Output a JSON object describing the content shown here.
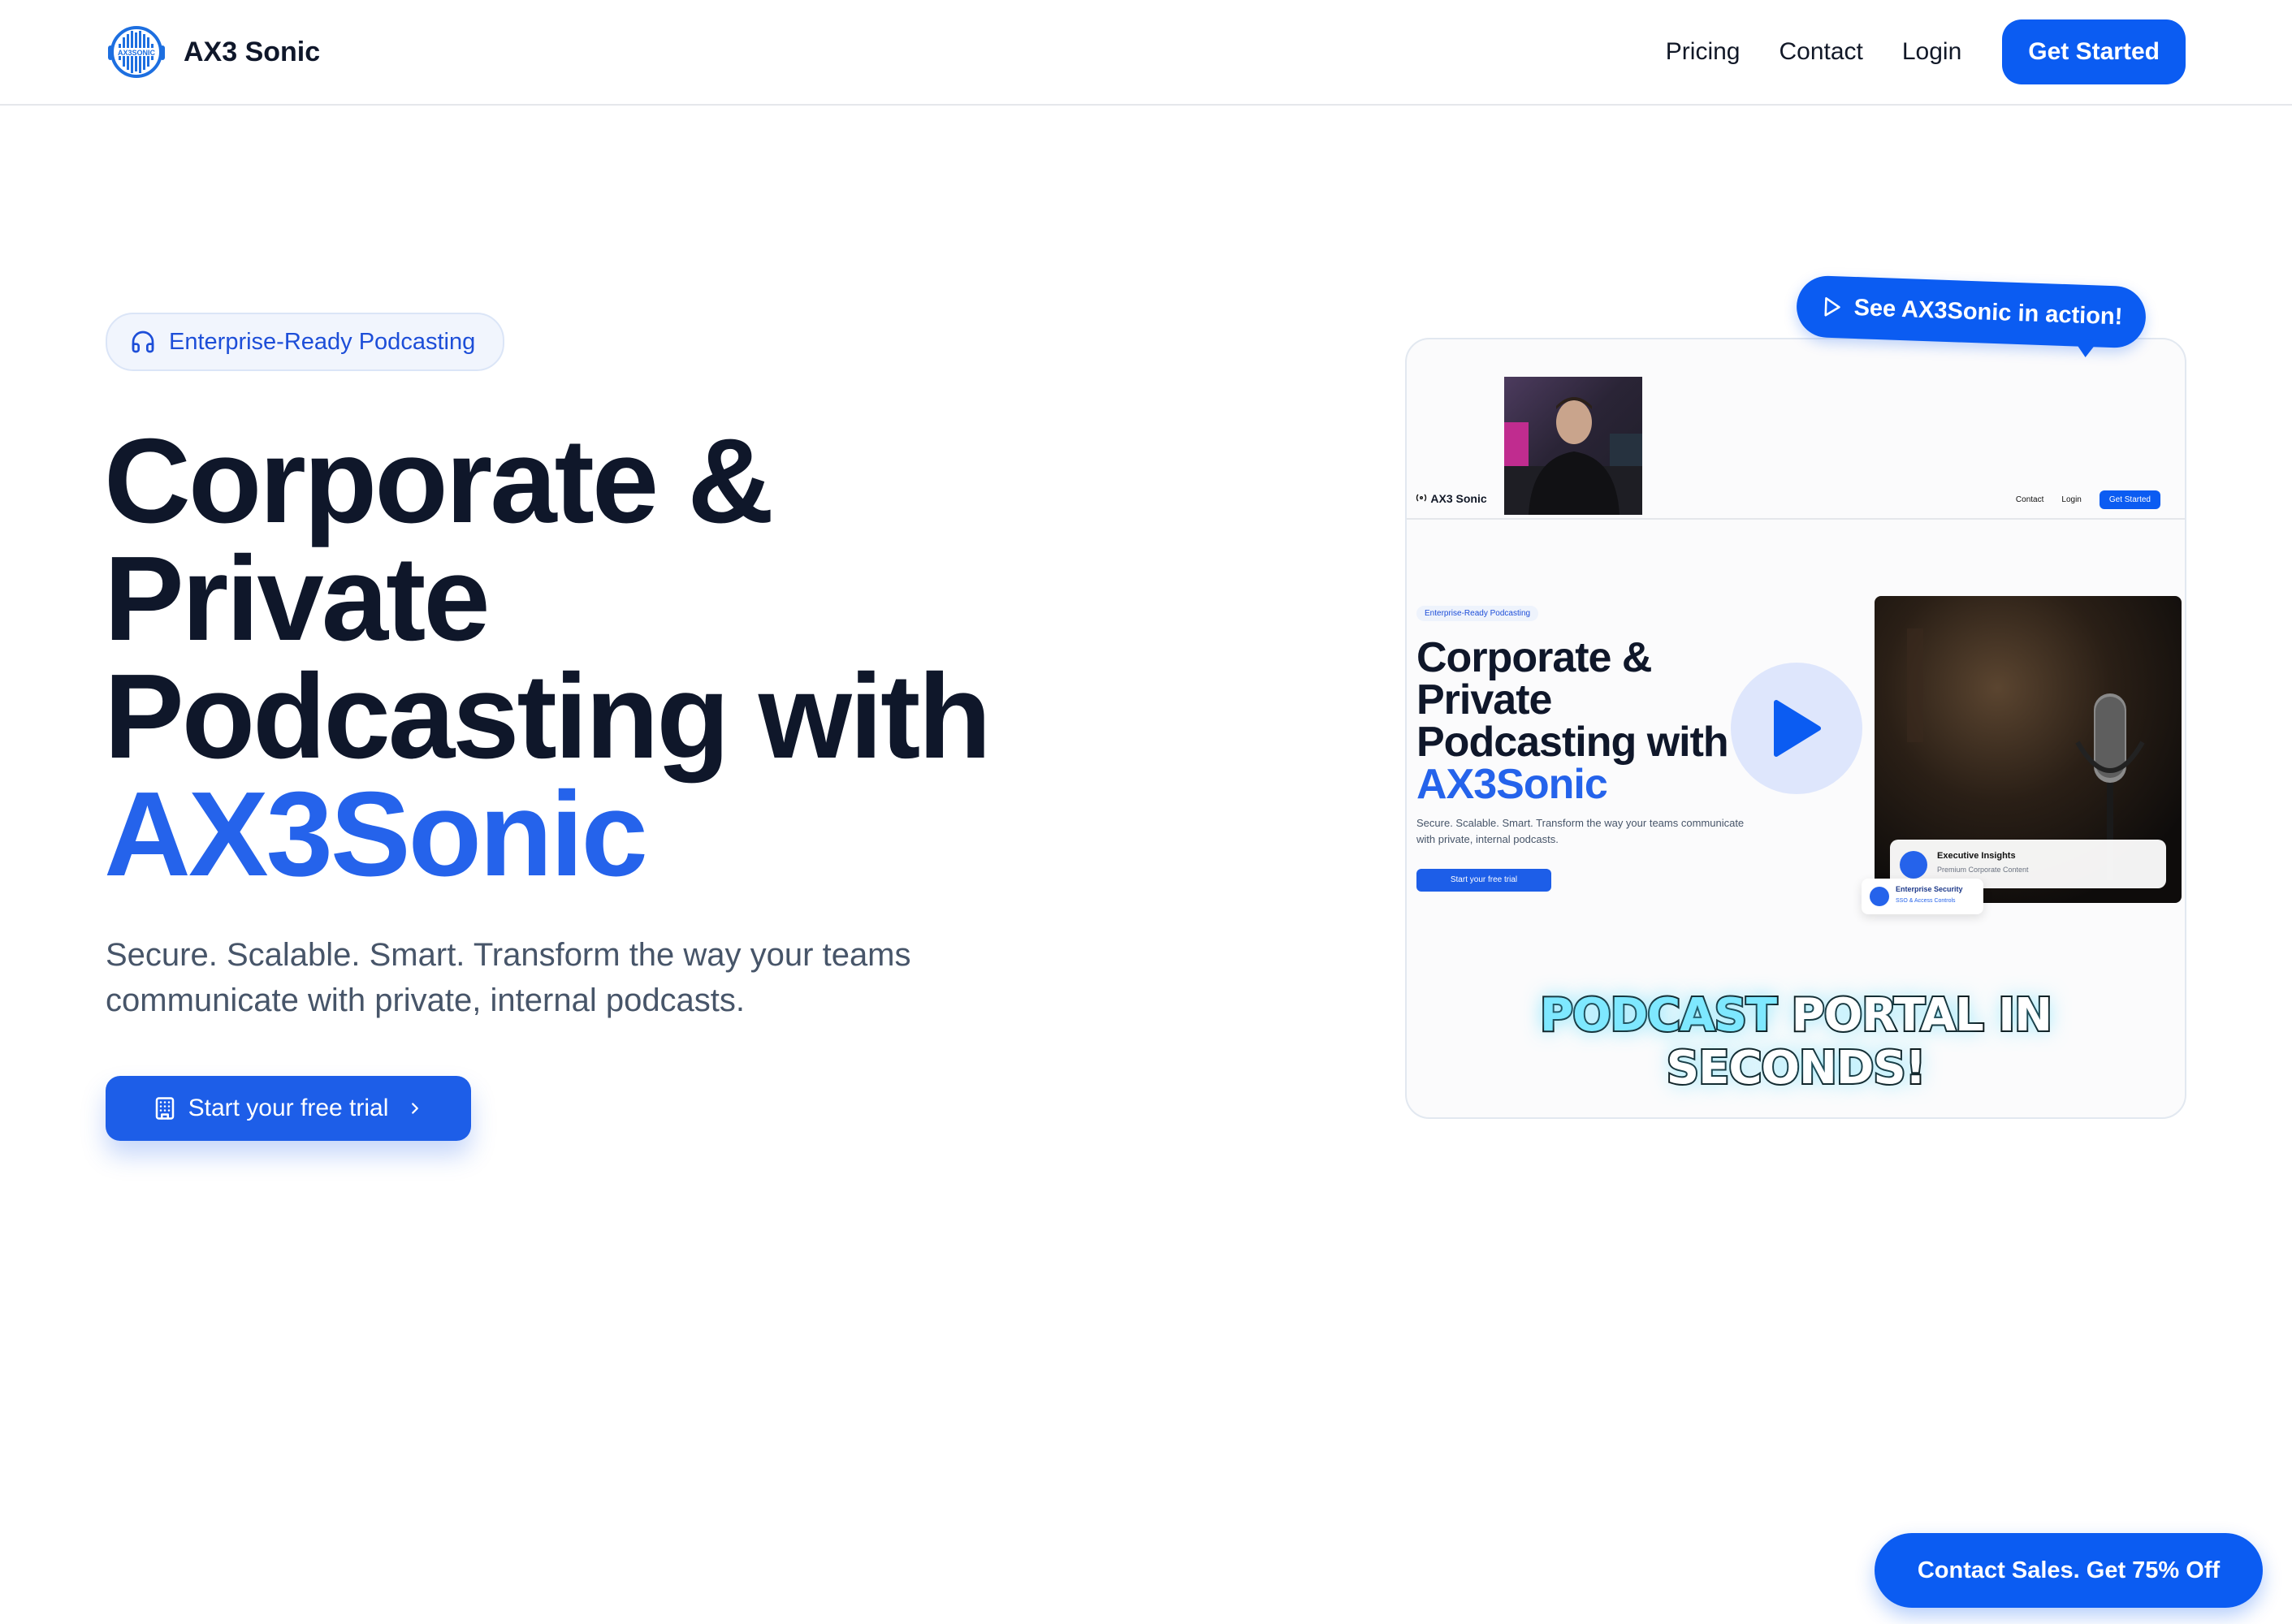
{
  "brand": {
    "name": "AX3 Sonic",
    "logo_text": "AX3SONIC"
  },
  "nav": {
    "links": [
      "Pricing",
      "Contact",
      "Login"
    ],
    "cta": "Get Started"
  },
  "hero": {
    "badge": "Enterprise-Ready Podcasting",
    "headline_lines": [
      "Corporate &",
      "Private",
      "Podcasting with"
    ],
    "headline_accent": "AX3Sonic",
    "subtitle": "Secure. Scalable. Smart. Transform the way your teams communicate with private, internal podcasts.",
    "cta": "Start your free trial"
  },
  "video": {
    "bubble": "See AX3Sonic in action!",
    "mini_brand": "AX3 Sonic",
    "mini_links": [
      "Contact",
      "Login"
    ],
    "mini_cta": "Get Started",
    "mini_badge": "Enterprise-Ready Podcasting",
    "mini_headline_lines": [
      "Corporate &",
      "Private",
      "Podcasting with"
    ],
    "mini_accent": "AX3Sonic",
    "mini_subtitle": "Secure. Scalable. Smart. Transform the way your teams communicate with private, internal podcasts.",
    "mini_btn": "Start your free trial",
    "card1_title": "Executive Insights",
    "card1_sub": "Premium Corporate Content",
    "card2_title": "Enterprise Security",
    "card2_sub": "SSO & Access Controls",
    "promo_part1": "PODCAST",
    "promo_part2": " PORTAL IN SECONDS!"
  },
  "floating": {
    "contact_sales": "Contact Sales. Get 75% Off"
  },
  "colors": {
    "primary": "#0b5cf2",
    "accent_text": "#2563eb",
    "heading": "#0f172a",
    "body": "#475569"
  },
  "icons": [
    "logo-waveform-icon",
    "headphones-icon",
    "building-icon",
    "chevron-right-icon",
    "play-outline-icon",
    "play-icon",
    "radio-icon"
  ]
}
